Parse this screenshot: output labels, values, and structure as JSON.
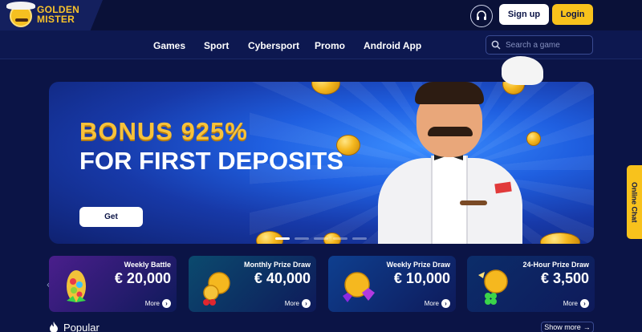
{
  "brand": {
    "name_line1": "GOLDEN",
    "name_line2": "MISTER"
  },
  "header": {
    "signup_label": "Sign up",
    "login_label": "Login"
  },
  "nav": {
    "items": [
      {
        "label": "Games"
      },
      {
        "label": "Sport"
      },
      {
        "label": "Cybersport"
      },
      {
        "label": "Promo"
      },
      {
        "label": "Android App"
      }
    ],
    "search_placeholder": "Search a game"
  },
  "banner": {
    "headline": "BONUS 925%",
    "subheadline": "FOR FIRST DEPOSITS",
    "cta_label": "Get",
    "slide_count": 5
  },
  "online_chat_label": "Online Chat",
  "prizes": [
    {
      "title": "Weekly Battle",
      "amount": "€ 20,000",
      "more_label": "More",
      "color": "#4a1e8c"
    },
    {
      "title": "Monthly Prize Draw",
      "amount": "€ 40,000",
      "more_label": "More",
      "color": "#0b4a6e"
    },
    {
      "title": "Weekly Prize Draw",
      "amount": "€ 10,000",
      "more_label": "More",
      "color": "#0e3f8f"
    },
    {
      "title": "24-Hour Prize Draw",
      "amount": "€ 3,500",
      "more_label": "More",
      "color": "#0c2d6a"
    }
  ],
  "popular": {
    "label": "Popular",
    "show_more_label": "Show more"
  },
  "colors": {
    "accent": "#f8c21c",
    "background": "#0b1446",
    "nav": "#0d1850"
  },
  "icons": [
    "headset-icon",
    "search-icon",
    "fire-icon",
    "arrow-right-icon",
    "chevron-left-icon",
    "chevron-right-icon"
  ]
}
